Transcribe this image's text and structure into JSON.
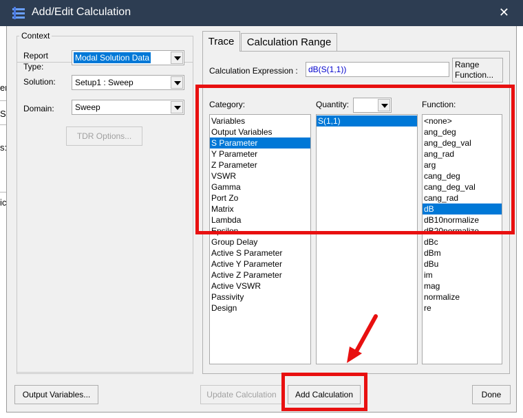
{
  "window": {
    "title": "Add/Edit Calculation",
    "close_glyph": "✕",
    "app_icon": "hfss-icon"
  },
  "background": {
    "fragments": [
      "er",
      "S",
      "s:",
      "ic"
    ]
  },
  "context": {
    "group_title": "Context",
    "report_type_label_1": "Report",
    "report_type_label_2": "Type:",
    "report_type_value": "Modal Solution Data",
    "solution_label": "Solution:",
    "solution_value": "Setup1 : Sweep",
    "domain_label": "Domain:",
    "domain_value": "Sweep",
    "tdr_options_button": "TDR Options..."
  },
  "tabs": [
    {
      "label": "Trace",
      "active": true
    },
    {
      "label": "Calculation Range",
      "active": false
    }
  ],
  "trace": {
    "expression_label": "Calculation Expression :",
    "expression_value": "dB(S(1,1))",
    "range_function_button_line1": "Range",
    "range_function_button_line2": "Function...",
    "category_label": "Category:",
    "quantity_label": "Quantity:",
    "quantity_filter_value": "",
    "function_label": "Function:",
    "categories": [
      "Variables",
      "Output Variables",
      "S Parameter",
      "Y Parameter",
      "Z Parameter",
      "VSWR",
      "Gamma",
      "Port Zo",
      "Matrix",
      "Lambda",
      "Epsilon",
      "Group Delay",
      "Active S Parameter",
      "Active Y Parameter",
      "Active Z Parameter",
      "Active VSWR",
      "Passivity",
      "Design"
    ],
    "selected_category": "S Parameter",
    "quantities": [
      "S(1,1)"
    ],
    "selected_quantity": "S(1,1)",
    "functions": [
      "<none>",
      "ang_deg",
      "ang_deg_val",
      "ang_rad",
      "arg",
      "cang_deg",
      "cang_deg_val",
      "cang_rad",
      "dB",
      "dB10normalize",
      "dB20normalize",
      "dBc",
      "dBm",
      "dBu",
      "im",
      "mag",
      "normalize",
      "re"
    ],
    "selected_function": "dB"
  },
  "footer": {
    "output_variables_button": "Output Variables...",
    "update_calculation_button": "Update Calculation",
    "add_calculation_button": "Add Calculation",
    "done_button": "Done"
  },
  "annotations": {
    "highlight_color": "#e81010"
  }
}
